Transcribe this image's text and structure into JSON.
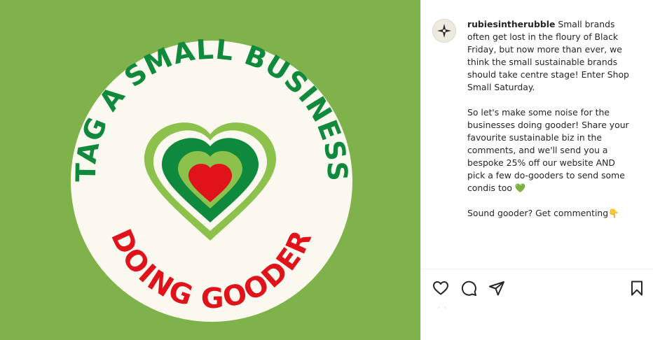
{
  "post": {
    "image": {
      "top_text": "TAG A SMALL BUSINESS",
      "bottom_text": "DOING GOODER",
      "colors": {
        "background": "#7fb24a",
        "circle": "#fbf8ef",
        "top_text": "#0f8a3c",
        "bottom_text": "#e0131b",
        "heart_outer": "#8cc14c",
        "heart_band": "#0f8a3c",
        "heart_light": "#8cc14c",
        "heart_inner": "#e0131b"
      }
    },
    "author": {
      "username": "rubiesintherubble",
      "avatar_icon": "star-logo-icon"
    },
    "caption": {
      "first_line": "Small brands often get lost in the floury of Black Friday, but now more than ever, we think the small sustainable brands should take centre stage! Enter Shop Small Saturday.",
      "paragraph_2": "So let's make some noise for the businesses doing gooder! Share your favourite sustainable biz in the comments, and we'll send you a bespoke 25% off our website AND pick a few do-gooders to send some condis too",
      "emoji_2": "💚",
      "paragraph_3": "Sound gooder? Get commenting",
      "emoji_3": "👇"
    },
    "actions": {
      "like_icon": "heart-icon",
      "comment_icon": "comment-icon",
      "share_icon": "send-icon",
      "save_icon": "bookmark-icon"
    }
  }
}
